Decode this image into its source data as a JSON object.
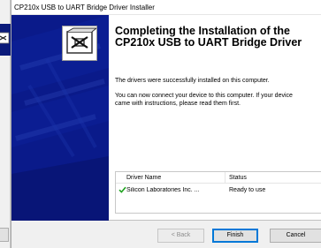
{
  "window": {
    "title": "CP210x USB to UART Bridge Driver Installer",
    "heading": "Completing the Installation of the CP210x USB to UART Bridge Driver",
    "message1": "The drivers were successfully installed on this computer.",
    "message2_line1": "You can now connect your device to this computer. If your device",
    "message2_line2": "came with instructions, please read them first."
  },
  "driver_list": {
    "headers": [
      "Driver Name",
      "Status"
    ],
    "rows": [
      {
        "name": "Silicon Laboratories Inc. ...",
        "status": "Ready to use",
        "icon": "checkmark-icon"
      }
    ]
  },
  "buttons": {
    "back": "< Back",
    "finish": "Finish",
    "cancel": "Cancel"
  },
  "colors": {
    "side_panel": "#0a1a8a",
    "check": "#1fa31f",
    "default_button_border": "#0078d7"
  }
}
